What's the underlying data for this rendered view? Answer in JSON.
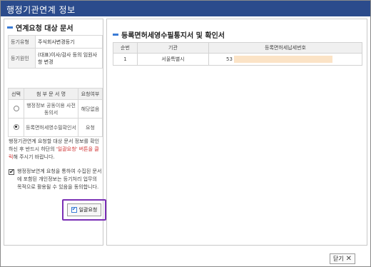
{
  "window": {
    "title": "행정기관연계 정보"
  },
  "left": {
    "section_title": "연계요청 대상 문서",
    "info": [
      {
        "label": "등기유형",
        "value": "주식회사변경등기"
      },
      {
        "label": "등기원인",
        "value": "(대표)이사/감사 등의 임원사항 변경"
      }
    ],
    "doc_table": {
      "headers": [
        "선택",
        "첨 부 문 서 명",
        "요청여부"
      ],
      "rows": [
        {
          "selected": false,
          "name": "행정정보 공동이용 사전동의서",
          "status": "해당없음"
        },
        {
          "selected": true,
          "name": "등록면허세영수필확인서",
          "status": "요청"
        }
      ]
    },
    "notice_prefix": "행정기관연계 요청할 대상 문서 정보를 확인하신 후 반드시 하단의 ",
    "notice_highlight": "'일괄요청' 버튼을 클릭",
    "notice_suffix": "해 주시기 바랍니다.",
    "agree_checked": true,
    "agree_text": "행정정보연계 요청을 통하여 수집된 문서에 포함된 개인정보는 등기처리 업무의 목적으로 활용될 수 있음을 동의합니다.",
    "request_button": "일괄요청"
  },
  "right": {
    "section_title": "등록면허세영수필통지서 및 확인서",
    "headers": [
      "순번",
      "기관",
      "등록면허세납세번호"
    ],
    "rows": [
      {
        "no": "1",
        "agency": "서울특별시",
        "tax_number": "53"
      }
    ]
  },
  "footer": {
    "close_label": "닫기"
  }
}
